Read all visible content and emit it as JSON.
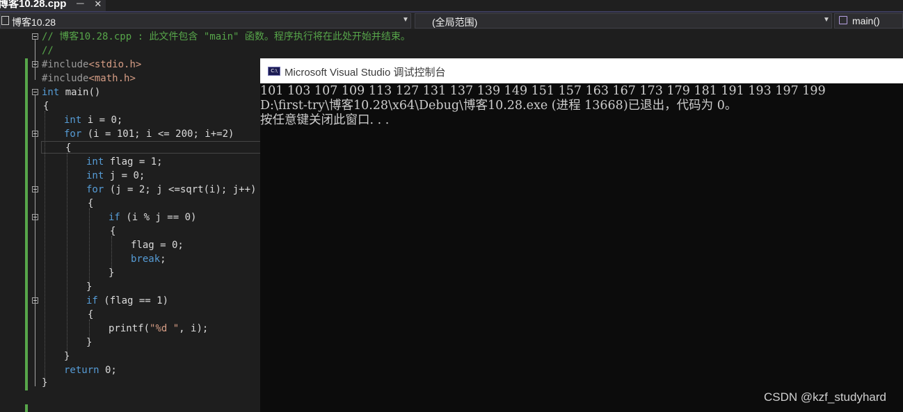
{
  "tab": {
    "label": "博客10.28.cpp",
    "pin": "ᅳ",
    "close": "✕"
  },
  "nav": {
    "project": "博客10.28",
    "scope": "(全局范围)",
    "member": "main()"
  },
  "code": {
    "l1": "// 博客10.28.cpp : 此文件包含 \"main\" 函数。程序执行将在此处开始并结束。",
    "l2": "//",
    "l3_directive": "#include",
    "l3_header": "<stdio.h>",
    "l4_directive": "#include",
    "l4_header": "<math.h>",
    "l5_type": "int",
    "l5_rest": " main()",
    "l6": "{",
    "l7_type": "int",
    "l7_rest": " i = 0;",
    "l8_kw": "for",
    "l8_rest": " (i = 101; i <= 200; i+=2)",
    "l9": "{",
    "l10_type": "int",
    "l10_rest": " flag = 1;",
    "l11_type": "int",
    "l11_rest": " j = 0;",
    "l12_kw": "for",
    "l12_rest": " (j = 2; j <=sqrt(i); j++)",
    "l13": "{",
    "l14_kw": "if",
    "l14_rest": " (i % j == 0)",
    "l15": "{",
    "l16": "flag = 0;",
    "l17_kw": "break",
    "l17_rest": ";",
    "l18": "}",
    "l19": "}",
    "l20_kw": "if",
    "l20_rest": " (flag == 1)",
    "l21": "{",
    "l22_fn": "printf(",
    "l22_str": "\"%d \"",
    "l22_rest": ", i);",
    "l23": "}",
    "l24": "}",
    "l25_kw": "return",
    "l25_rest": " 0;",
    "l26": "}"
  },
  "console": {
    "title": "Microsoft Visual Studio 调试控制台",
    "icon_text": "C:\\",
    "output": "101 103 107 109 113 127 131 137 139 149 151 157 163 167 173 179 181 191 193 197 199",
    "exit_msg": "D:\\first-try\\博客10.28\\x64\\Debug\\博客10.28.exe (进程 13668)已退出，代码为 0。",
    "prompt": "按任意键关闭此窗口. . ."
  },
  "watermark": "CSDN @kzf_studyhard",
  "colors": {
    "keyword": "#569cd6",
    "comment": "#57a64a",
    "string": "#d69d85",
    "change_bar": "#57a64a"
  }
}
